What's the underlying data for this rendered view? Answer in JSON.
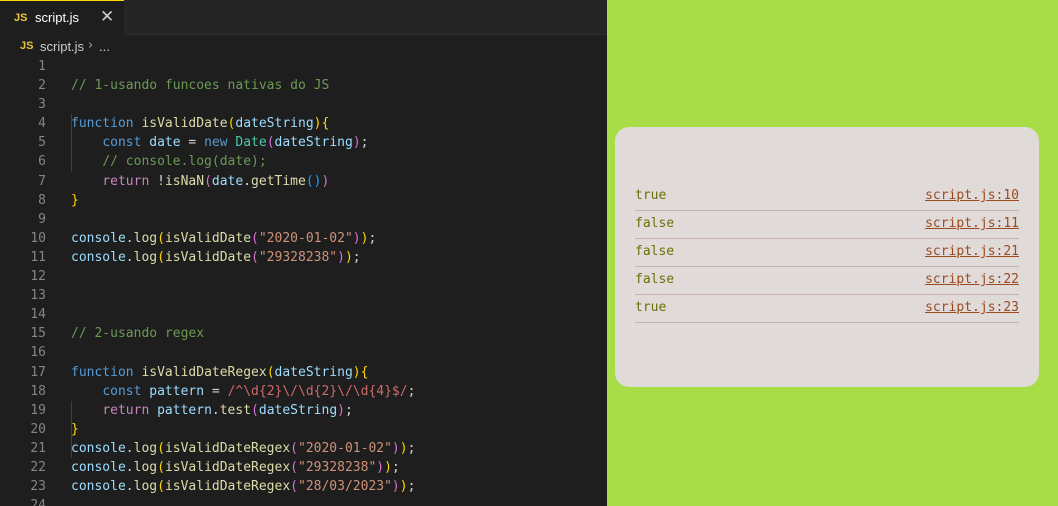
{
  "editor": {
    "tab": {
      "icon_text": "JS",
      "label": "script.js",
      "close_glyph": "✕"
    },
    "breadcrumb": {
      "icon_text": "JS",
      "file": "script.js",
      "separator": "›",
      "more": "..."
    },
    "lines": [
      {
        "n": "1",
        "t": []
      },
      {
        "n": "2",
        "t": [
          [
            "c",
            "// 1-usando funcoes nativas do JS"
          ]
        ]
      },
      {
        "n": "3",
        "t": []
      },
      {
        "n": "4",
        "t": [
          [
            "k",
            "function "
          ],
          [
            "f",
            "isValidDate"
          ],
          [
            "y",
            "("
          ],
          [
            "v",
            "dateString"
          ],
          [
            "y",
            ")"
          ],
          [
            "y",
            "{"
          ]
        ]
      },
      {
        "n": "5",
        "t": [
          [
            "p",
            "    "
          ],
          [
            "k",
            "const "
          ],
          [
            "v",
            "date"
          ],
          [
            "p",
            " = "
          ],
          [
            "k",
            "new "
          ],
          [
            "cls",
            "Date"
          ],
          [
            "m",
            "("
          ],
          [
            "v",
            "dateString"
          ],
          [
            "m",
            ")"
          ],
          [
            "p",
            ";"
          ]
        ]
      },
      {
        "n": "6",
        "t": [
          [
            "p",
            "    "
          ],
          [
            "c",
            "// console.log(date);"
          ]
        ]
      },
      {
        "n": "7",
        "t": [
          [
            "p",
            "    "
          ],
          [
            "kc",
            "return "
          ],
          [
            "p",
            "!"
          ],
          [
            "f",
            "isNaN"
          ],
          [
            "m",
            "("
          ],
          [
            "v",
            "date"
          ],
          [
            "p",
            "."
          ],
          [
            "f",
            "getTime"
          ],
          [
            "b",
            "()"
          ],
          [
            "m",
            ")"
          ]
        ]
      },
      {
        "n": "8",
        "t": [
          [
            "y",
            "}"
          ]
        ]
      },
      {
        "n": "9",
        "t": []
      },
      {
        "n": "10",
        "t": [
          [
            "v",
            "console"
          ],
          [
            "p",
            "."
          ],
          [
            "f",
            "log"
          ],
          [
            "y",
            "("
          ],
          [
            "f",
            "isValidDate"
          ],
          [
            "m",
            "("
          ],
          [
            "s",
            "\"2020-01-02\""
          ],
          [
            "m",
            ")"
          ],
          [
            "y",
            ")"
          ],
          [
            "p",
            ";"
          ]
        ]
      },
      {
        "n": "11",
        "t": [
          [
            "v",
            "console"
          ],
          [
            "p",
            "."
          ],
          [
            "f",
            "log"
          ],
          [
            "y",
            "("
          ],
          [
            "f",
            "isValidDate"
          ],
          [
            "m",
            "("
          ],
          [
            "s",
            "\"29328238\""
          ],
          [
            "m",
            ")"
          ],
          [
            "y",
            ")"
          ],
          [
            "p",
            ";"
          ]
        ]
      },
      {
        "n": "12",
        "t": []
      },
      {
        "n": "13",
        "t": []
      },
      {
        "n": "14",
        "t": []
      },
      {
        "n": "15",
        "t": [
          [
            "c",
            "// 2-usando regex"
          ]
        ]
      },
      {
        "n": "16",
        "t": []
      },
      {
        "n": "17",
        "t": [
          [
            "k",
            "function "
          ],
          [
            "f",
            "isValidDateRegex"
          ],
          [
            "y",
            "("
          ],
          [
            "v",
            "dateString"
          ],
          [
            "y",
            ")"
          ],
          [
            "y",
            "{"
          ]
        ]
      },
      {
        "n": "18",
        "t": [
          [
            "p",
            "    "
          ],
          [
            "k",
            "const "
          ],
          [
            "v",
            "pattern"
          ],
          [
            "p",
            " = "
          ],
          [
            "r",
            "/^\\d{2}\\/\\d{2}\\/\\d{4}$/"
          ],
          [
            "p",
            ";"
          ]
        ]
      },
      {
        "n": "19",
        "t": [
          [
            "p",
            "    "
          ],
          [
            "kc",
            "return "
          ],
          [
            "v",
            "pattern"
          ],
          [
            "p",
            "."
          ],
          [
            "f",
            "test"
          ],
          [
            "m",
            "("
          ],
          [
            "v",
            "dateString"
          ],
          [
            "m",
            ")"
          ],
          [
            "p",
            ";"
          ]
        ]
      },
      {
        "n": "20",
        "t": [
          [
            "y",
            "}"
          ]
        ]
      },
      {
        "n": "21",
        "t": [
          [
            "v",
            "console"
          ],
          [
            "p",
            "."
          ],
          [
            "f",
            "log"
          ],
          [
            "y",
            "("
          ],
          [
            "f",
            "isValidDateRegex"
          ],
          [
            "m",
            "("
          ],
          [
            "s",
            "\"2020-01-02\""
          ],
          [
            "m",
            ")"
          ],
          [
            "y",
            ")"
          ],
          [
            "p",
            ";"
          ]
        ]
      },
      {
        "n": "22",
        "t": [
          [
            "v",
            "console"
          ],
          [
            "p",
            "."
          ],
          [
            "f",
            "log"
          ],
          [
            "y",
            "("
          ],
          [
            "f",
            "isValidDateRegex"
          ],
          [
            "m",
            "("
          ],
          [
            "s",
            "\"29328238\""
          ],
          [
            "m",
            ")"
          ],
          [
            "y",
            ")"
          ],
          [
            "p",
            ";"
          ]
        ]
      },
      {
        "n": "23",
        "t": [
          [
            "v",
            "console"
          ],
          [
            "p",
            "."
          ],
          [
            "f",
            "log"
          ],
          [
            "y",
            "("
          ],
          [
            "f",
            "isValidDateRegex"
          ],
          [
            "m",
            "("
          ],
          [
            "s",
            "\"28/03/2023\""
          ],
          [
            "m",
            ")"
          ],
          [
            "y",
            ")"
          ],
          [
            "p",
            ";"
          ]
        ]
      },
      {
        "n": "24",
        "t": []
      }
    ]
  },
  "console": {
    "rows": [
      {
        "value": "true",
        "source": "script.js:10"
      },
      {
        "value": "false",
        "source": "script.js:11"
      },
      {
        "value": "false",
        "source": "script.js:21"
      },
      {
        "value": "false",
        "source": "script.js:22"
      },
      {
        "value": "true",
        "source": "script.js:23"
      }
    ]
  },
  "colors": {
    "page_background": "#a9dd48",
    "editor_background": "#1e1e1e",
    "console_background": "#e0dbd8",
    "console_value": "#6e6e0a",
    "console_link": "#9b4a22"
  }
}
